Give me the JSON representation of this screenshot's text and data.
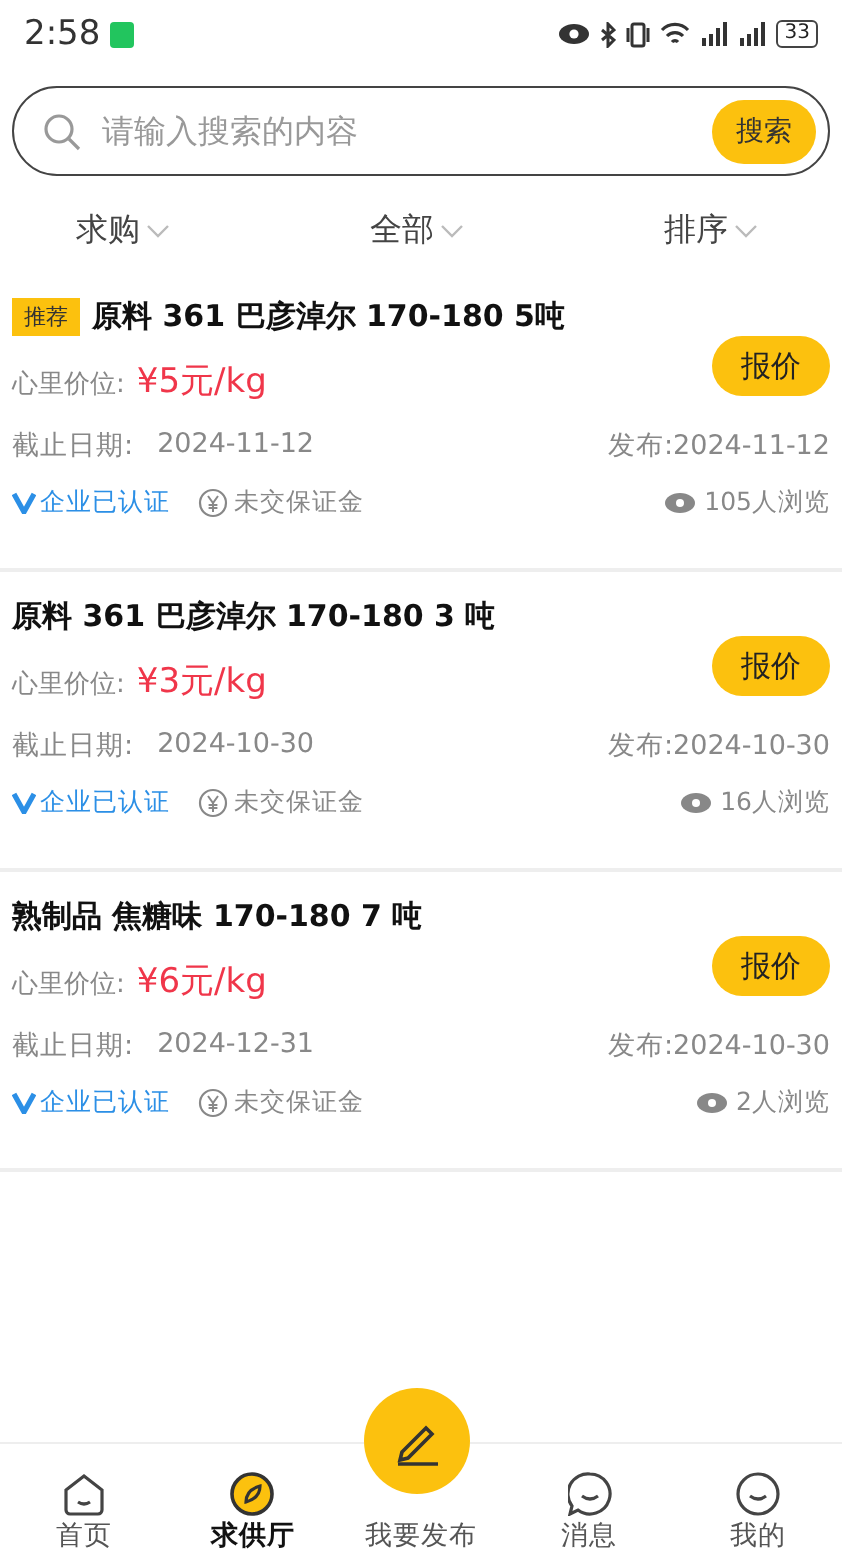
{
  "status_bar": {
    "time": "2:58",
    "battery": "33"
  },
  "search": {
    "placeholder": "请输入搜索的内容",
    "button": "搜索"
  },
  "filters": [
    {
      "label": "求购"
    },
    {
      "label": "全部"
    },
    {
      "label": "排序"
    }
  ],
  "listings": [
    {
      "badge": "推荐",
      "title": "原料 361 巴彦淖尔 170-180 5吨",
      "price_label": "心里价位:",
      "price": "¥5元/kg",
      "action": "报价",
      "deadline_label": "截止日期:",
      "deadline": "2024-11-12",
      "published": "发布:2024-11-12",
      "verified": "企业已认证",
      "deposit": "未交保证金",
      "views": "105人浏览"
    },
    {
      "title": "原料 361 巴彦淖尔 170-180 3 吨",
      "price_label": "心里价位:",
      "price": "¥3元/kg",
      "action": "报价",
      "deadline_label": "截止日期:",
      "deadline": "2024-10-30",
      "published": "发布:2024-10-30",
      "verified": "企业已认证",
      "deposit": "未交保证金",
      "views": "16人浏览"
    },
    {
      "title": "熟制品 焦糖味 170-180 7 吨",
      "price_label": "心里价位:",
      "price": "¥6元/kg",
      "action": "报价",
      "deadline_label": "截止日期:",
      "deadline": "2024-12-31",
      "published": "发布:2024-10-30",
      "verified": "企业已认证",
      "deposit": "未交保证金",
      "views": "2人浏览"
    }
  ],
  "tabs": [
    {
      "kind": "home",
      "label": "首页",
      "selected": false
    },
    {
      "kind": "compass",
      "label": "求供厅",
      "selected": true
    },
    {
      "kind": "publish",
      "label": "我要发布",
      "selected": false
    },
    {
      "kind": "message",
      "label": "消息",
      "selected": false
    },
    {
      "kind": "profile",
      "label": "我的",
      "selected": false
    }
  ]
}
